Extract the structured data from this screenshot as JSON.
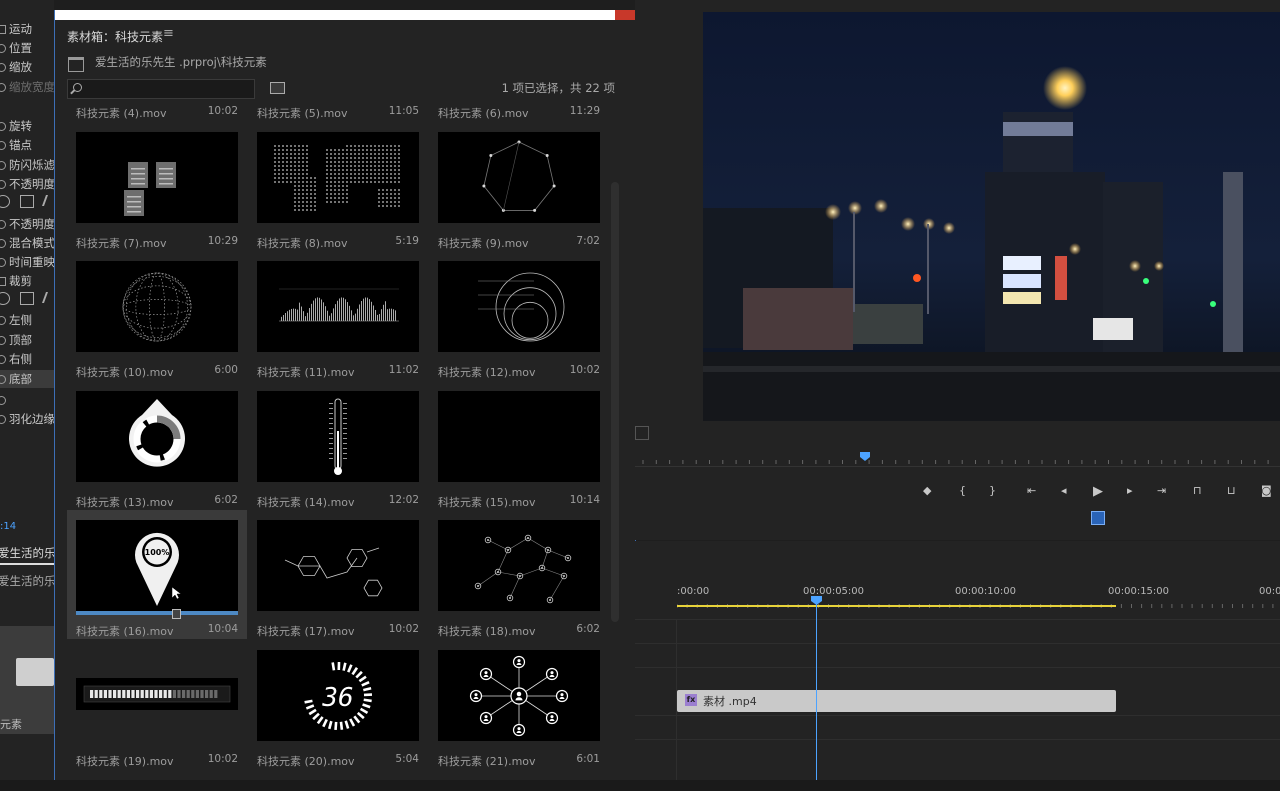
{
  "effect_controls": {
    "top_fragment": "",
    "rows": [
      {
        "label": "运动",
        "icon": "transform-icon",
        "dim": false
      },
      {
        "label": "位置",
        "dim": false
      },
      {
        "label": "缩放",
        "dim": false
      },
      {
        "label": "缩放宽度",
        "dim": true
      },
      {
        "label": "旋转",
        "dim": false
      },
      {
        "label": "锚点",
        "dim": false
      },
      {
        "label": "防闪烁滤",
        "dim": false
      },
      {
        "label": "不透明度",
        "dim": false
      },
      {
        "label": "不透明度",
        "dim": false
      },
      {
        "label": "混合模式",
        "dim": false
      },
      {
        "label": "时间重映射",
        "dim": false
      },
      {
        "label": "裁剪",
        "icon": "transform-icon",
        "dim": false
      },
      {
        "label": "左侧",
        "dim": false
      },
      {
        "label": "顶部",
        "dim": false
      },
      {
        "label": "右侧",
        "dim": false
      },
      {
        "label": "底部",
        "dim": false,
        "selected": true
      },
      {
        "label": "",
        "dim": false
      },
      {
        "label": "羽化边缘",
        "dim": false
      }
    ],
    "timecode_fragment": ":14",
    "tab1": "爱生活的乐",
    "tab2": "爱生活的乐",
    "bin_thumb_label": "元素"
  },
  "bin": {
    "title": "素材箱：科技元素",
    "menu_icon": "≡",
    "path": "爱生活的乐先生 .prproj\\科技元素",
    "search_placeholder": "",
    "selection_status": "1 项已选择，共 22 项",
    "clips": [
      {
        "name": "科技元素 (4).mov",
        "dur": "10:02",
        "thumb": "none",
        "partial": true
      },
      {
        "name": "科技元素 (5).mov",
        "dur": "11:05",
        "thumb": "none",
        "partial": true
      },
      {
        "name": "科技元素 (6).mov",
        "dur": "11:29",
        "thumb": "none",
        "partial": true
      },
      {
        "name": "科技元素 (7).mov",
        "dur": "10:29",
        "thumb": "docs"
      },
      {
        "name": "科技元素 (8).mov",
        "dur": "5:19",
        "thumb": "worldmap"
      },
      {
        "name": "科技元素 (9).mov",
        "dur": "7:02",
        "thumb": "polygon"
      },
      {
        "name": "科技元素 (10).mov",
        "dur": "6:00",
        "thumb": "sphere"
      },
      {
        "name": "科技元素 (11).mov",
        "dur": "11:02",
        "thumb": "barchart"
      },
      {
        "name": "科技元素 (12).mov",
        "dur": "10:02",
        "thumb": "circles"
      },
      {
        "name": "科技元素 (13).mov",
        "dur": "6:02",
        "thumb": "donut"
      },
      {
        "name": "科技元素 (14).mov",
        "dur": "12:02",
        "thumb": "thermometer"
      },
      {
        "name": "科技元素 (15).mov",
        "dur": "10:14",
        "thumb": "blank"
      },
      {
        "name": "科技元素 (16).mov",
        "dur": "10:04",
        "thumb": "pin",
        "selected": true,
        "pin_text": "100%"
      },
      {
        "name": "科技元素 (17).mov",
        "dur": "10:02",
        "thumb": "molecule"
      },
      {
        "name": "科技元素 (18).mov",
        "dur": "6:02",
        "thumb": "network"
      },
      {
        "name": "科技元素 (19).mov",
        "dur": "10:02",
        "thumb": "progressbar"
      },
      {
        "name": "科技元素 (20).mov",
        "dur": "5:04",
        "thumb": "counter",
        "counter_text": "36"
      },
      {
        "name": "科技元素 (21).mov",
        "dur": "6:01",
        "thumb": "people"
      }
    ]
  },
  "monitor": {
    "controls": [
      "marker-icon",
      "mark-in-icon",
      "mark-out-icon",
      "go-to-in-icon",
      "step-back-icon",
      "play-icon",
      "step-forward-icon",
      "go-to-out-icon",
      "lift-icon",
      "extract-icon",
      "export-frame-icon"
    ]
  },
  "timeline": {
    "timecodes": [
      ":00:00",
      "00:00:05:00",
      "00:00:10:00",
      "00:00:15:00",
      "00:0"
    ],
    "clip_name": "素材 .mp4",
    "clip_fx": "fx"
  },
  "colors": {
    "accent": "#4ca3ff",
    "work_area": "#e8d33a",
    "selection": "#3d6fb7"
  }
}
